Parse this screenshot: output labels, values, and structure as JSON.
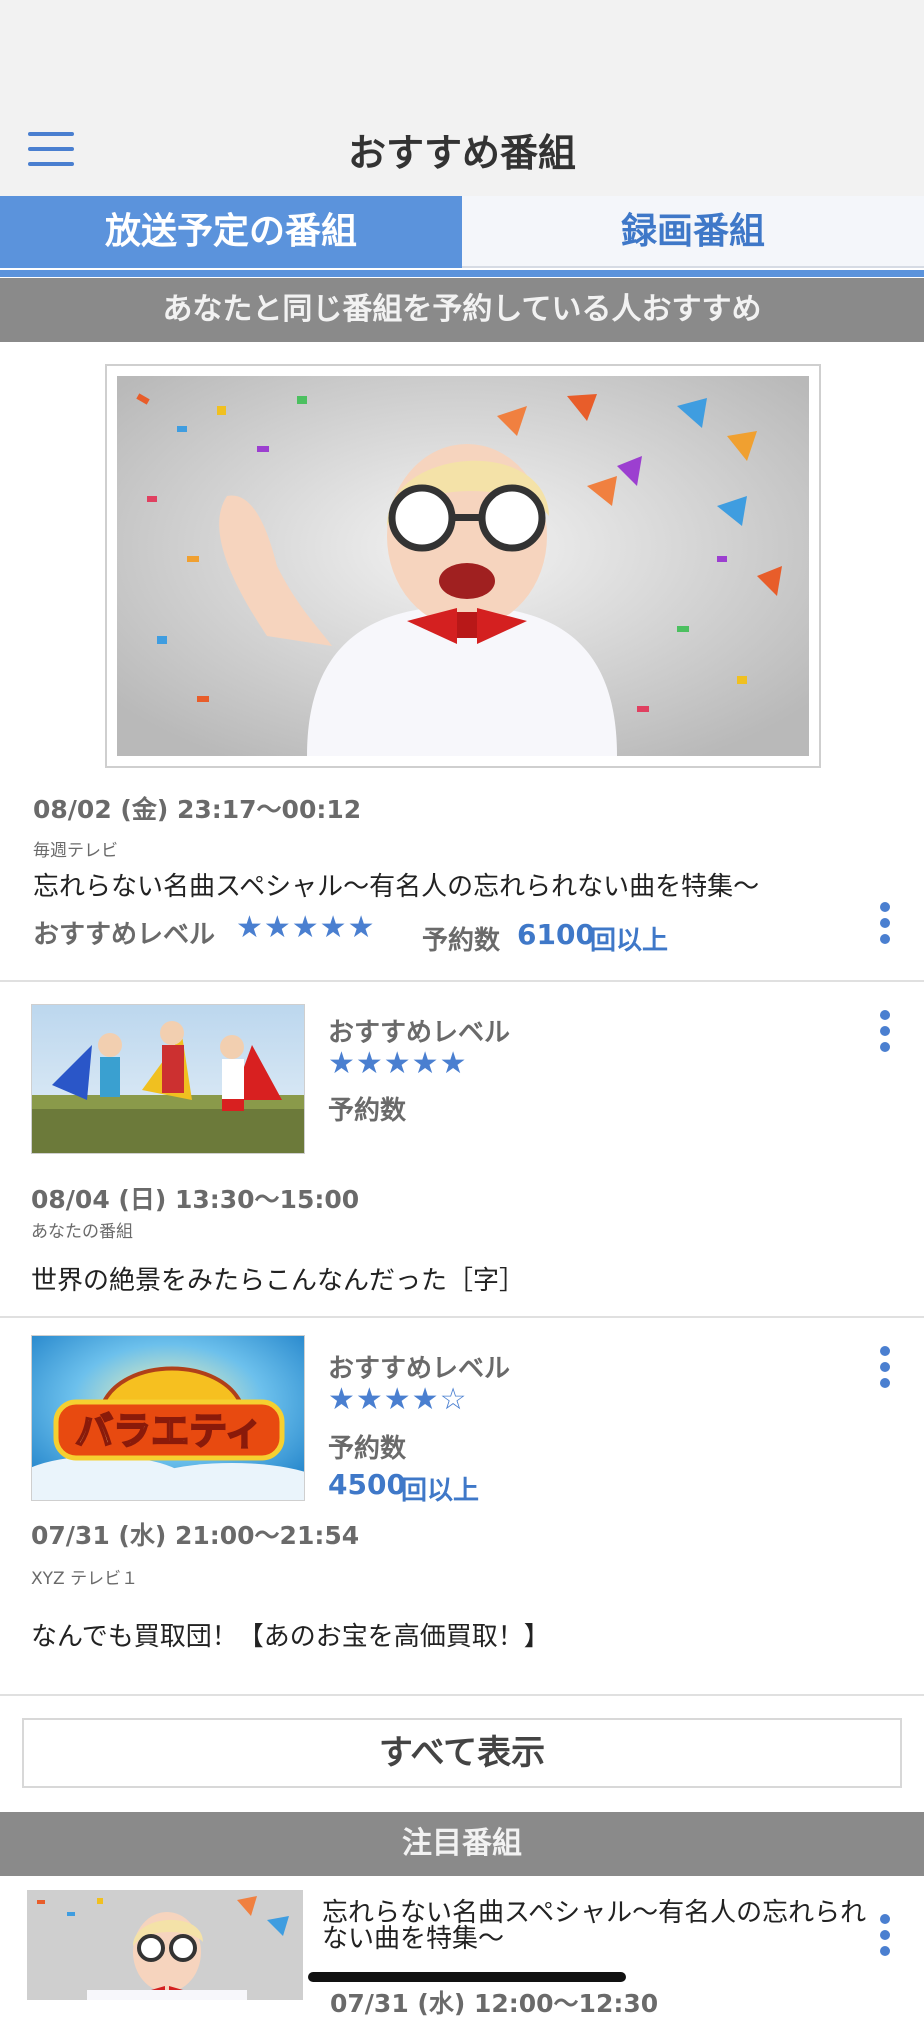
{
  "header": {
    "title": "おすすめ番組"
  },
  "tabs": [
    {
      "label": "放送予定の番組",
      "active": true
    },
    {
      "label": "録画番組",
      "active": false
    }
  ],
  "section1": {
    "title": "あなたと同じ番組を予約している人おすすめ"
  },
  "featured": {
    "datetime": "08/02 (金) 23:17〜00:12",
    "channel": "毎週テレビ",
    "title": "忘れらない名曲スペシャル〜有名人の忘れられない曲を特集〜",
    "rec_label": "おすすめレベル",
    "stars": "★★★★★",
    "count_label": "予約数",
    "count_value": "6100",
    "count_suffix": "回以上"
  },
  "items": [
    {
      "rec_label": "おすすめレベル",
      "stars": "★★★★★",
      "count_label": "予約数",
      "datetime": "08/04 (日) 13:30〜15:00",
      "channel": "あなたの番組",
      "title": "世界の絶景をみたらこんなんだった［字］"
    },
    {
      "image_text": "バラエティ",
      "rec_label": "おすすめレベル",
      "stars": "★★★★☆",
      "count_label": "予約数",
      "count_value": "4500",
      "count_suffix": "回以上",
      "datetime": "07/31 (水) 21:00〜21:54",
      "channel": "XYZ テレビ１",
      "title": "なんでも買取団！【あのお宝を高価買取！】"
    }
  ],
  "show_all": "すべて表示",
  "section2": {
    "title": "注目番組"
  },
  "spotlight": {
    "title_line1": "忘れらない名曲スペシャル〜有名人の忘れられ",
    "title_line2": "ない曲を特集〜",
    "datetime": "07/31 (水) 12:00〜12:30"
  },
  "colors": {
    "accent": "#5b93dc",
    "link": "#3f78c8",
    "section_bg": "#8a8a8a"
  }
}
